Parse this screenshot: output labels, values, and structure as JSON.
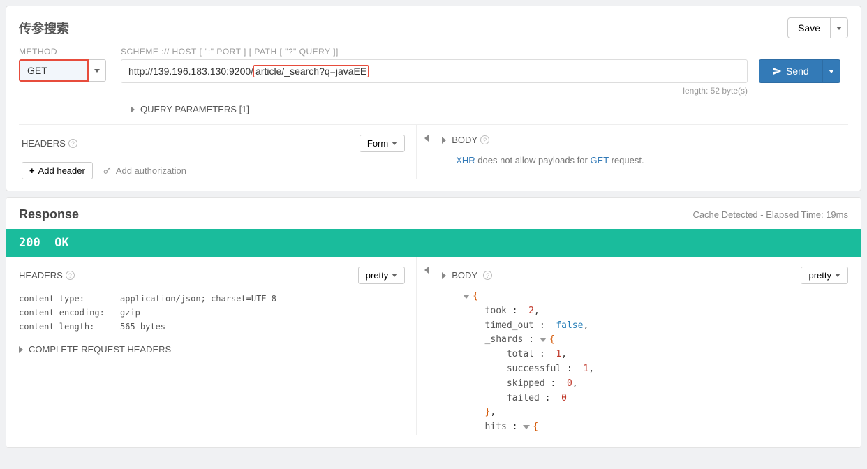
{
  "request": {
    "title": "传参搜索",
    "save_label": "Save",
    "method_label": "METHOD",
    "method_value": "GET",
    "url_label": "SCHEME :// HOST [ \":\" PORT ] [ PATH [ \"?\" QUERY ]]",
    "url_plain": "http://139.196.183.130:9200/",
    "url_highlighted": "article/_search?q=javaEE",
    "url_length": "length: 52 byte(s)",
    "send_label": "Send",
    "query_params_label": "QUERY PARAMETERS [1]",
    "headers_label": "HEADERS",
    "form_label": "Form",
    "add_header_label": "Add header",
    "add_auth_label": "Add authorization",
    "body_label": "BODY",
    "body_msg_prefix": "XHR",
    "body_msg_middle": " does not allow payloads for ",
    "body_msg_method": "GET",
    "body_msg_suffix": " request."
  },
  "response": {
    "title": "Response",
    "meta": "Cache Detected - Elapsed Time: 19ms",
    "status_code": "200",
    "status_text": "OK",
    "headers_label": "HEADERS",
    "pretty_label": "pretty",
    "body_label": "BODY",
    "headers": [
      {
        "key": "content-type:",
        "value": "application/json; charset=UTF-8"
      },
      {
        "key": "content-encoding:",
        "value": "gzip"
      },
      {
        "key": "content-length:",
        "value": "565 bytes"
      }
    ],
    "complete_headers_label": "COMPLETE REQUEST HEADERS",
    "json_lines": [
      {
        "indent": 0,
        "type": "brace-open",
        "toggle": true
      },
      {
        "indent": 1,
        "key": "took",
        "value": "2",
        "vtype": "num",
        "comma": true
      },
      {
        "indent": 1,
        "key": "timed_out",
        "value": "false",
        "vtype": "bool",
        "comma": true
      },
      {
        "indent": 1,
        "key": "_shards",
        "type": "obj-open",
        "toggle": true
      },
      {
        "indent": 2,
        "key": "total",
        "value": "1",
        "vtype": "num",
        "comma": true
      },
      {
        "indent": 2,
        "key": "successful",
        "value": "1",
        "vtype": "num",
        "comma": true
      },
      {
        "indent": 2,
        "key": "skipped",
        "value": "0",
        "vtype": "num",
        "comma": true
      },
      {
        "indent": 2,
        "key": "failed",
        "value": "0",
        "vtype": "num",
        "comma": false
      },
      {
        "indent": 1,
        "type": "brace-close",
        "comma": true
      },
      {
        "indent": 1,
        "key": "hits",
        "type": "obj-open",
        "toggle": true
      }
    ]
  }
}
